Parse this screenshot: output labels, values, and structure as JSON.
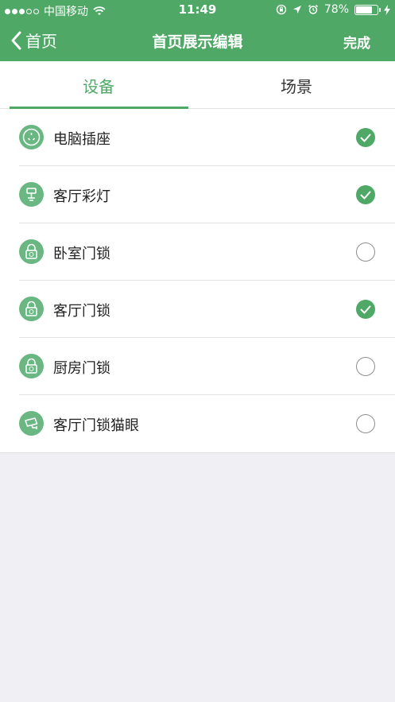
{
  "colors": {
    "primary": "#4fa866",
    "icon_bg": "#6bb784",
    "background": "#efeff4"
  },
  "status_bar": {
    "carrier": "中国移动",
    "time": "11:49",
    "battery_percent": "78%",
    "battery_level": 0.78
  },
  "nav": {
    "back_label": "首页",
    "title": "首页展示编辑",
    "done_label": "完成"
  },
  "tabs": [
    {
      "label": "设备",
      "active": true
    },
    {
      "label": "场景",
      "active": false
    }
  ],
  "devices": [
    {
      "label": "电脑插座",
      "icon": "socket-icon",
      "checked": true
    },
    {
      "label": "客厅彩灯",
      "icon": "lamp-icon",
      "checked": true
    },
    {
      "label": "卧室门锁",
      "icon": "lock-icon",
      "checked": false
    },
    {
      "label": "客厅门锁",
      "icon": "lock-icon",
      "checked": true
    },
    {
      "label": "厨房门锁",
      "icon": "lock-icon",
      "checked": false
    },
    {
      "label": "客厅门锁猫眼",
      "icon": "camera-icon",
      "checked": false
    }
  ]
}
